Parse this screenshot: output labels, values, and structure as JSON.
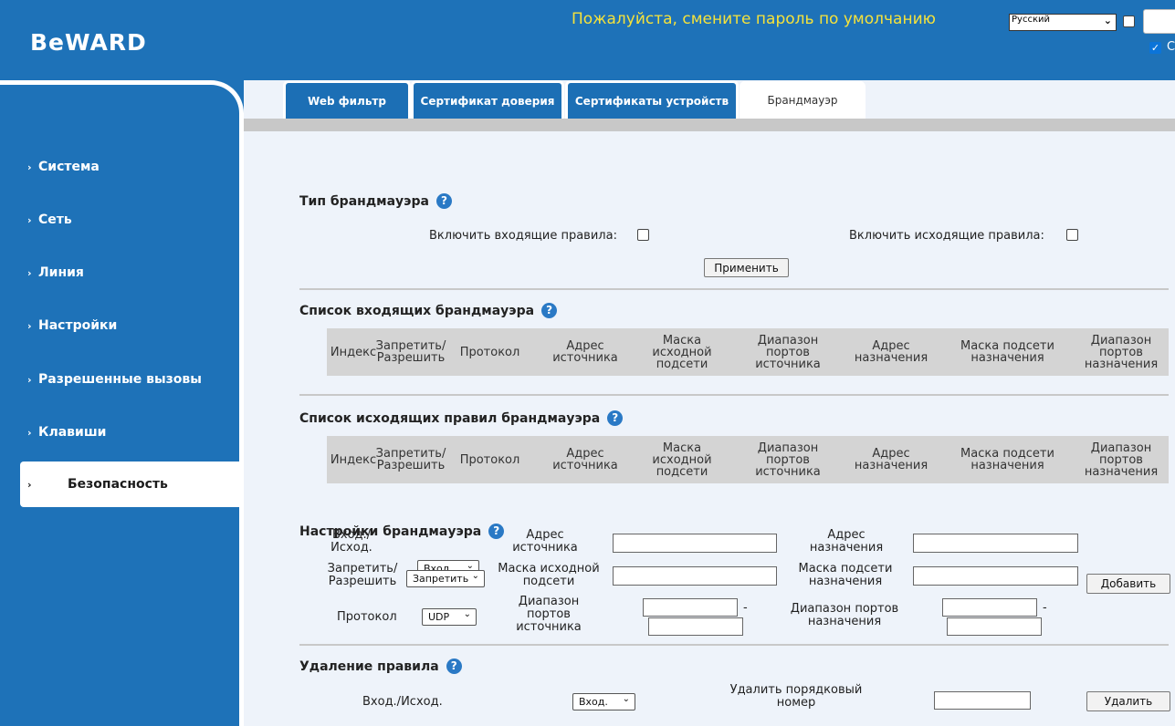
{
  "header": {
    "logo": "BeWARD",
    "banner": "Пожалуйста, смените пароль по умолчанию",
    "language": "Русский",
    "cb2_label": "С"
  },
  "sidebar": {
    "items": [
      {
        "label": "Система"
      },
      {
        "label": "Сеть"
      },
      {
        "label": "Линия"
      },
      {
        "label": "Настройки"
      },
      {
        "label": "Разрешенные вызовы"
      },
      {
        "label": "Клавиши"
      },
      {
        "label": "Безопасность"
      }
    ]
  },
  "tabs": [
    {
      "label": "Web фильтр"
    },
    {
      "label": "Сертификат доверия"
    },
    {
      "label": "Сертификаты устройств"
    },
    {
      "label": "Брандмауэр"
    }
  ],
  "firewall_type": {
    "title": "Тип брандмауэра",
    "inbound_label": "Включить входящие правила:",
    "outbound_label": "Включить исходящие правила:",
    "apply": "Применить"
  },
  "inbound_list": {
    "title": "Список входящих брандмауэра"
  },
  "outbound_list": {
    "title": "Список исходящих правил брандмауэра"
  },
  "columns": {
    "index": "Индекс",
    "deny_allow": "Запретить/ Разрешить",
    "protocol": "Протокол",
    "src_addr": "Адрес источника",
    "src_mask": "Маска исходной подсети",
    "src_ports": "Диапазон портов источника",
    "dst_addr": "Адрес назначения",
    "dst_mask": "Маска подсети назначения",
    "dst_ports": "Диапазон портов назначения"
  },
  "settings": {
    "title": "Настройки брандмауэра",
    "direction_label": "Вход./ Исход.",
    "direction_value": "Вход.",
    "src_addr_label": "Адрес источника",
    "dst_addr_label": "Адрес назначения",
    "action_label": "Запретить/ Разрешить",
    "action_value": "Запретить",
    "src_mask_label": "Маска исходной подсети",
    "dst_mask_label": "Маска подсети назначения",
    "add": "Добавить",
    "protocol_label": "Протокол",
    "protocol_value": "UDP",
    "src_ports_label": "Диапазон портов источника",
    "dst_ports_label": "Диапазон портов назначения",
    "dash": "-"
  },
  "delete": {
    "title": "Удаление правила",
    "direction_label": "Вход./Исход.",
    "direction_value": "Вход.",
    "index_label": "Удалить порядковый номер",
    "button": "Удалить"
  },
  "icons": {
    "help": "?",
    "chevron": "›",
    "dropdown": "⌄",
    "check": "✓"
  }
}
